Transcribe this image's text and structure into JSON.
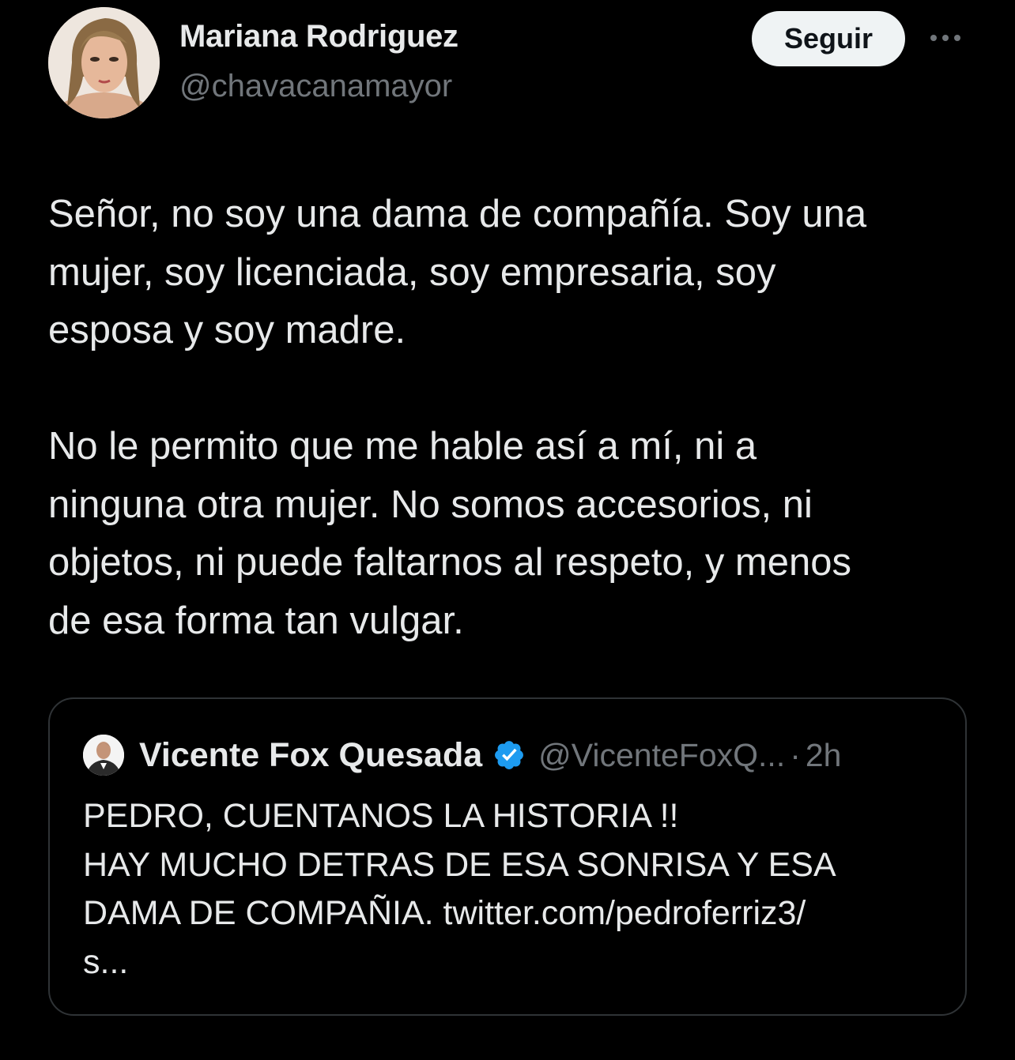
{
  "tweet": {
    "author": {
      "name": "Mariana Rodriguez",
      "handle": "@chavacanamayor",
      "avatar_icon": "profile-photo"
    },
    "follow_label": "Seguir",
    "more_icon": "more-horizontal-icon",
    "paragraphs": [
      "Señor, no soy una dama de compañía. Soy una\nmujer, soy licenciada, soy empresaria, soy\nesposa y soy madre.",
      "No le permito que me hable así a mí, ni a\nninguna otra mujer. No somos accesorios, ni\nobjetos, ni puede faltarnos al respeto, y menos\nde esa forma tan vulgar."
    ]
  },
  "quoted_tweet": {
    "author": {
      "name": "Vicente Fox Quesada",
      "handle": "@VicenteFoxQ...",
      "verified": true,
      "verified_icon": "verified-badge-icon",
      "avatar_icon": "profile-photo"
    },
    "separator": "·",
    "time": "2h",
    "text": "PEDRO, CUENTANOS LA HISTORIA !!\nHAY MUCHO DETRAS DE ESA SONRISA Y ESA\nDAMA DE COMPAÑIA. twitter.com/pedroferriz3/\ns..."
  },
  "colors": {
    "background": "#000000",
    "primary_text": "#e7e9ea",
    "secondary_text": "#71767b",
    "border": "#2f3336",
    "follow_button_bg": "#eff3f4",
    "verified_blue": "#1d9bf0"
  }
}
